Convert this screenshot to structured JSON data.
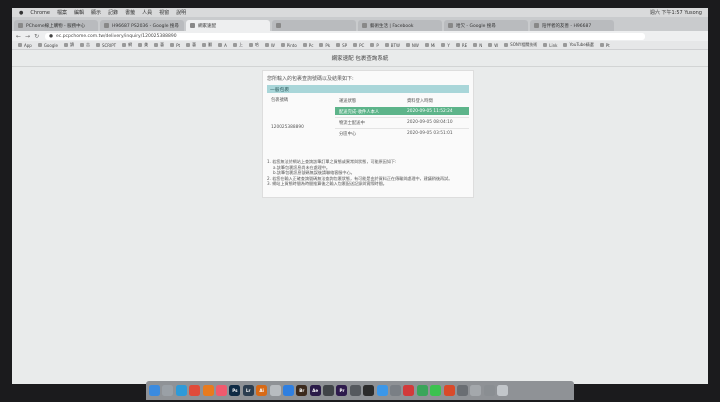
{
  "menubar": {
    "items": [
      "Chrome",
      "檔案",
      "編輯",
      "顯示",
      "記錄",
      "書籤",
      "人員",
      "視窗",
      "說明"
    ],
    "right": "週六 下午1:57  Yusong"
  },
  "tabs": [
    {
      "label": "PChome線上購物 - 服務中心",
      "active": false
    },
    {
      "label": "H96687 PS2036 - Google 搜尋",
      "active": false
    },
    {
      "label": "網家速配",
      "active": true
    },
    {
      "label": "",
      "active": false
    },
    {
      "label": "藝術生活 | Facebook",
      "active": false
    },
    {
      "label": "哈欠 - Google 搜尋",
      "active": false
    },
    {
      "label": "陪伴者的友善 - H96687",
      "active": false
    }
  ],
  "address": {
    "url": "ec.pcpchome.com.tw/delivery/inquiry/120025388890"
  },
  "bookmarks": [
    "App",
    "Google",
    "讀",
    "吉",
    "SCRIPT",
    "網",
    "美",
    "藝",
    "Pt",
    "藝",
    "翻",
    "A",
    "上",
    "哈",
    "W",
    "Pinto",
    "Pc",
    "Pk",
    "SP",
    "PC",
    "P",
    "BTW",
    "NW",
    "Mi",
    "Y",
    "RE",
    "N",
    "W",
    "SONY相關技術",
    "Link",
    "YouTube精選",
    "Pt"
  ],
  "page": {
    "header": "網家速配 包裹查詢系統",
    "question": "您所輸入的包裹查詢號碼以及結果如下:",
    "section_title": "一般包裹",
    "columns": {
      "number": "包裹號碼",
      "status": "運送狀態",
      "time": "資料登入時間"
    },
    "package_number": "120025388890",
    "rows": [
      {
        "status": "配送完成-收件人本人",
        "time": "2020-09-05 11:52:24"
      },
      {
        "status": "物流士配送中",
        "time": "2020-09-05 08:04:10"
      },
      {
        "status": "分區中心",
        "time": "2020-09-05 03:51:01"
      }
    ],
    "notes": [
      "1. 若您無法於網站上查詢該筆訂單之貨態或異常與狀態，可能原因如下:",
      "   a.該筆包裹訊息尚未在處理中。",
      "   b.該筆包裹訊息號碼無誤後請聯絡客服中心。",
      "2. 若您在輸入正確查詢號碼無法查詢包裹狀態，有可能是由於資料正在傳輸與處理中，建議稍後再試。",
      "3. 網站上貨態時間為時間推算後之輸入包裹配送記錄與實際時間。"
    ]
  },
  "dock": {
    "apps": [
      {
        "name": "finder",
        "label": "",
        "color": "#3b8be0"
      },
      {
        "name": "launchpad",
        "label": "",
        "color": "#9aa0a6"
      },
      {
        "name": "safari",
        "label": "",
        "color": "#2e9ad8"
      },
      {
        "name": "chrome",
        "label": "",
        "color": "#e04b3a"
      },
      {
        "name": "firefox",
        "label": "",
        "color": "#e87b1e"
      },
      {
        "name": "music",
        "label": "",
        "color": "#f05a6e"
      },
      {
        "name": "photoshop",
        "label": "Ps",
        "color": "#0e2a44"
      },
      {
        "name": "lightroom",
        "label": "Lr",
        "color": "#2b3d4f"
      },
      {
        "name": "illustrator",
        "label": "Ai",
        "color": "#d86a16"
      },
      {
        "name": "photos",
        "label": "",
        "color": "#b8bcc0"
      },
      {
        "name": "appstore",
        "label": "",
        "color": "#2f7fe0"
      },
      {
        "name": "bridge",
        "label": "Br",
        "color": "#3b2a1d"
      },
      {
        "name": "aftereffects",
        "label": "Ae",
        "color": "#2a1b49"
      },
      {
        "name": "finalcut",
        "label": "",
        "color": "#404448"
      },
      {
        "name": "premiere",
        "label": "Pr",
        "color": "#2d1a4c"
      },
      {
        "name": "media",
        "label": "",
        "color": "#55595e"
      },
      {
        "name": "terminal",
        "label": "",
        "color": "#2b2b2b"
      },
      {
        "name": "mail",
        "label": "",
        "color": "#3c97e8"
      },
      {
        "name": "settings",
        "label": "",
        "color": "#7a7f85"
      },
      {
        "name": "video",
        "label": "",
        "color": "#d23a3a"
      },
      {
        "name": "numbers",
        "label": "",
        "color": "#3aa55a"
      },
      {
        "name": "messages",
        "label": "",
        "color": "#3cc24f"
      },
      {
        "name": "app23",
        "label": "",
        "color": "#d94a2a"
      },
      {
        "name": "app24",
        "label": "",
        "color": "#6a6e73"
      },
      {
        "name": "app25",
        "label": "",
        "color": "#a4a8ac"
      },
      {
        "name": "app26",
        "label": "",
        "color": "#8a8e92"
      },
      {
        "name": "trash",
        "label": "",
        "color": "#c2c6ca"
      }
    ]
  }
}
